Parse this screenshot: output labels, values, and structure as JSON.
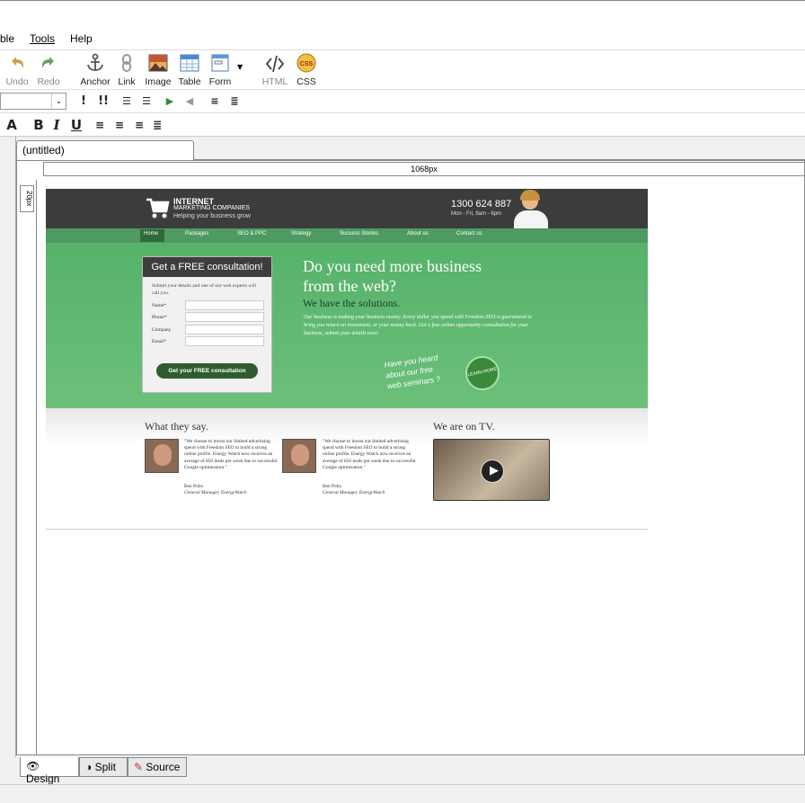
{
  "menu": [
    "ble",
    "Tools",
    "Help"
  ],
  "toolbar": {
    "undo": "Undo",
    "redo": "Redo",
    "anchor": "Anchor",
    "link": "Link",
    "image": "Image",
    "table": "Table",
    "form": "Form",
    "html": "HTML",
    "css": "CSS"
  },
  "format": {
    "bold": "B",
    "italic": "I",
    "underline": "U",
    "important1": "!",
    "important2": "!!"
  },
  "tab": {
    "title": "(untitled)"
  },
  "ruler": {
    "width_label": "1068px",
    "vertical_label": "20px"
  },
  "views": {
    "design": "Design",
    "split": "Split",
    "source": "Source"
  },
  "site": {
    "logo_line1": "INTERNET",
    "logo_line2": "MARKETING COMPANIES",
    "logo_tagline": "Helping your business grow",
    "phone": "1300 624 887",
    "hours": "Mon - Fri, 9am - 6pm",
    "nav": [
      "Home",
      "Packages",
      "SEO & PPC",
      "Strategy",
      "Success Stories",
      "About us",
      "Contact us"
    ],
    "form_title": "Get a FREE consultation!",
    "form_intro": "Submit your details and one of our web experts will call you.",
    "form_fields": [
      "Name*",
      "Phone*",
      "Company",
      "Email*"
    ],
    "form_button": "Get your FREE consultation",
    "headline1": "Do you need more business",
    "headline2": "from the web?",
    "subhead": "We have the solutions.",
    "body_text": "Our business is making your business money. Every dollar you spend with Freedom SEO is guaranteed to bring you return on investment, or your money back. Get a free online opportunity consultation for your business, submit your details now!",
    "webinar_line1": "Have you heard",
    "webinar_line2": "about our free",
    "webinar_line3": "web seminars ?",
    "learn_more": "LEARN MORE",
    "testimonials_title": "What they say.",
    "tv_title": "We are on TV.",
    "testimonials": [
      {
        "quote": "\"We choose to invest our limited advertising spend with Freedom SEO to build a strong online profile. Energy Watch now receives an average of 850 leads per week due to successful Google optimisation.\"",
        "name": "Ben Polis",
        "role": "General Manager, EnergyWatch"
      },
      {
        "quote": "\"We choose to invest our limited advertising spend with Freedom SEO to build a strong online profile. Energy Watch now receives an average of 850 leads per week due to successful Google optimisation.\"",
        "name": "Ben Polis",
        "role": "General Manager, EnergyWatch"
      }
    ]
  }
}
